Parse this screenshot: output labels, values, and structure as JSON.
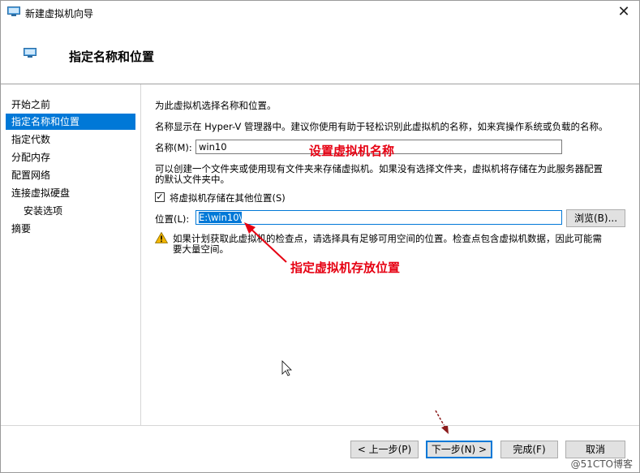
{
  "window": {
    "title": "新建虚拟机向导",
    "close_glyph": "✕"
  },
  "header": {
    "title": "指定名称和位置"
  },
  "nav": {
    "items": [
      {
        "label": "开始之前"
      },
      {
        "label": "指定名称和位置"
      },
      {
        "label": "指定代数"
      },
      {
        "label": "分配内存"
      },
      {
        "label": "配置网络"
      },
      {
        "label": "连接虚拟硬盘"
      },
      {
        "label": "安装选项"
      },
      {
        "label": "摘要"
      }
    ]
  },
  "main": {
    "intro": "为此虚拟机选择名称和位置。",
    "desc": "名称显示在 Hyper-V 管理器中。建议你使用有助于轻松识别此虚拟机的名称，如来宾操作系统或负载的名称。",
    "name_label": "名称(M):",
    "name_value": "win10",
    "folder_desc_1": "可以创建一个文件夹或使用现有文件夹来存储虚拟机。如果没有选择文件夹，虚拟机将存储在为此服务器配置",
    "folder_desc_2": "的默认文件夹中。",
    "checkbox_label": "将虚拟机存储在其他位置(S)",
    "checkbox_checked": true,
    "location_label": "位置(L):",
    "location_value": "E:\\win10\\",
    "browse_label": "浏览(B)...",
    "warning_1": "如果计划获取此虚拟机的检查点，请选择具有足够可用空间的位置。检查点包含虚拟机数据，因此可能需",
    "warning_2": "要大量空间。"
  },
  "annotations": {
    "name_note": "设置虚拟机名称",
    "location_note": "指定虚拟机存放位置"
  },
  "footer": {
    "prev": "< 上一步(P)",
    "next": "下一步(N) >",
    "finish": "完成(F)",
    "cancel": "取消"
  },
  "watermark": "@51CTO博客",
  "colors": {
    "accent": "#0078d7",
    "annotation": "#e60012",
    "warning": "#f2b500"
  }
}
